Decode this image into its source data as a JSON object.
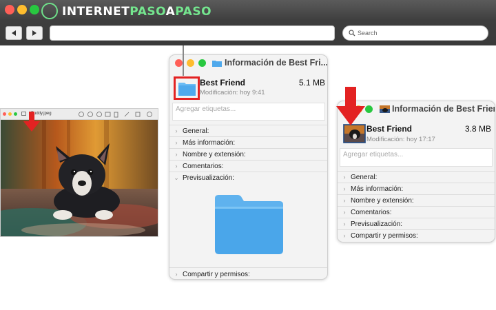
{
  "browser": {
    "logo": {
      "part1": "INTERNET",
      "part2": "PASO",
      "part3": "A",
      "part4": "PASO"
    },
    "back_icon": "back-arrow",
    "forward_icon": "forward-arrow",
    "search_placeholder": "Search",
    "search_icon": "magnifier"
  },
  "viewer": {
    "filename": "Buddy.jpeg"
  },
  "window1": {
    "title": "Información de Best Fri...",
    "name": "Best Friend",
    "size": "5.1 MB",
    "modified": "Modificación: hoy 9:41",
    "tags_placeholder": "Agregar etiquetas...",
    "sections": [
      "General:",
      "Más información:",
      "Nombre y extensión:",
      "Comentarios:",
      "Previsualización:"
    ],
    "footer_section": "Compartir y permisos:",
    "icon": "folder"
  },
  "window2": {
    "title": "Información de Best Friend",
    "name": "Best Friend",
    "size": "3.8 MB",
    "modified": "Modificación: hoy 17:17",
    "tags_placeholder": "Agregar etiquetas...",
    "sections": [
      "General:",
      "Más información:",
      "Nombre y extensión:",
      "Comentarios:",
      "Previsualización:",
      "Compartir y permisos:"
    ],
    "icon": "dog-photo-thumbnail"
  },
  "colors": {
    "highlight_red": "#e32222",
    "folder_blue": "#4fa9ec",
    "traffic_red": "#ff5f57",
    "traffic_yellow": "#febc2e",
    "traffic_green": "#28c840",
    "brand_green": "#74e58e"
  }
}
